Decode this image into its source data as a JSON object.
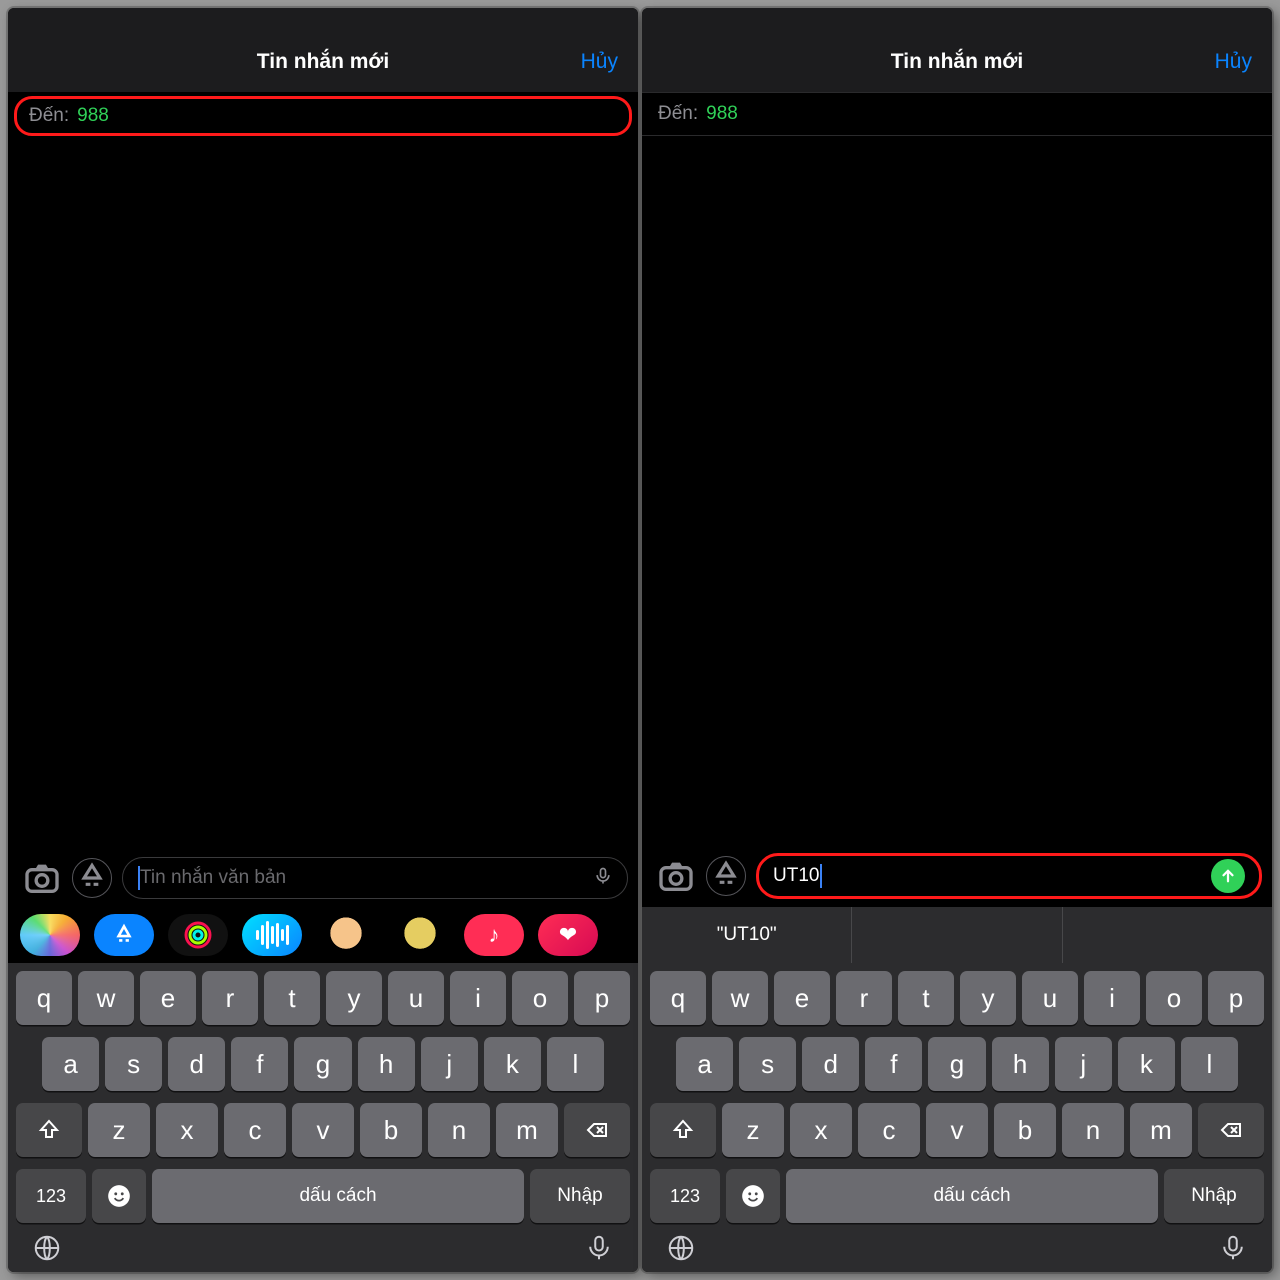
{
  "header": {
    "title": "Tin nhắn mới",
    "cancel": "Hủy"
  },
  "to": {
    "label": "Đến:",
    "value": "988"
  },
  "compose": {
    "placeholder": "Tin nhắn văn bản",
    "typed": "UT10"
  },
  "suggestion": {
    "text": "\"UT10\""
  },
  "keyboard": {
    "row1": [
      "q",
      "w",
      "e",
      "r",
      "t",
      "y",
      "u",
      "i",
      "o",
      "p"
    ],
    "row2": [
      "a",
      "s",
      "d",
      "f",
      "g",
      "h",
      "j",
      "k",
      "l"
    ],
    "row3": [
      "z",
      "x",
      "c",
      "v",
      "b",
      "n",
      "m"
    ],
    "numKey": "123",
    "space": "dấu cách",
    "enter": "Nhập"
  }
}
